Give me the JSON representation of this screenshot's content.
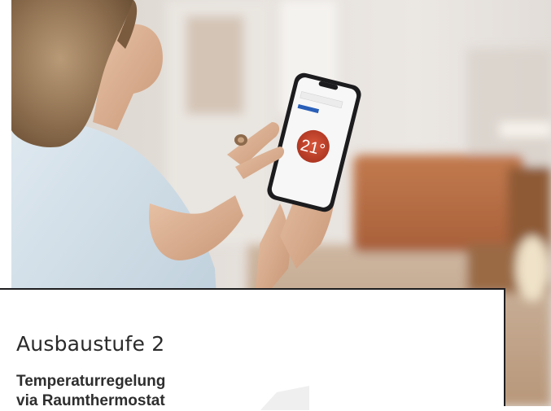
{
  "card": {
    "title": "Ausbaustufe 2",
    "subtitle_line1": "Temperaturregelung",
    "subtitle_line2": "via Raumthermostat"
  },
  "phone": {
    "temperature": "21°"
  },
  "colors": {
    "card_border": "#1d1d1f",
    "thermostat_circle": "#c7452d",
    "brand_text": "#2a5fb8"
  }
}
